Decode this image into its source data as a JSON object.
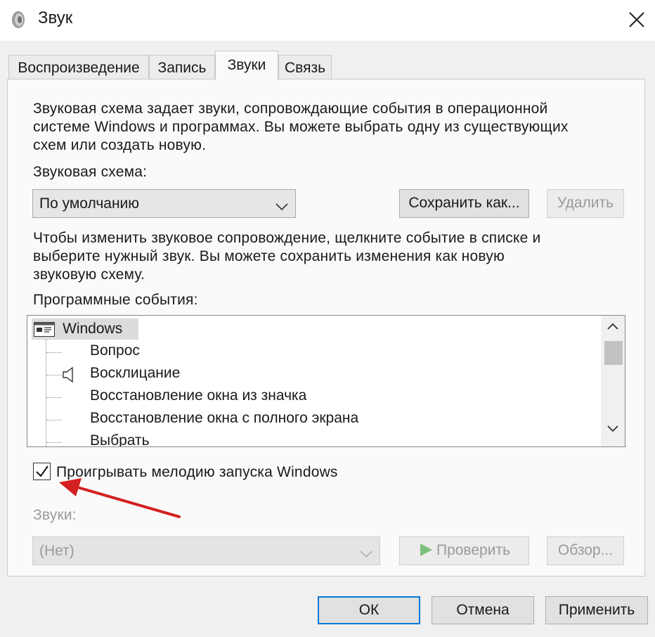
{
  "window": {
    "title": "Звук",
    "app_icon": "speaker-icon",
    "close_icon": "close-icon"
  },
  "tabs": [
    {
      "label": "Воспроизведение",
      "active": false
    },
    {
      "label": "Запись",
      "active": false
    },
    {
      "label": "Звуки",
      "active": true
    },
    {
      "label": "Связь",
      "active": false
    }
  ],
  "scheme": {
    "description": [
      "Звуковая схема задает звуки, сопровождающие события в операционной",
      "системе Windows и программах. Вы можете выбрать одну из существующих",
      "схем или создать новую."
    ],
    "label": "Звуковая схема:",
    "selected": "По умолчанию",
    "save_as_label": "Сохранить как...",
    "delete_label": "Удалить"
  },
  "events": {
    "instructions": [
      "Чтобы изменить звуковое сопровождение, щелкните событие в списке и",
      "выберите нужный звук. Вы можете сохранить изменения как новую",
      "звуковую схему."
    ],
    "label": "Программные события:",
    "root_label": "Windows",
    "items": [
      {
        "label": "Вопрос",
        "has_sound": false
      },
      {
        "label": "Восклицание",
        "has_sound": true
      },
      {
        "label": "Восстановление окна из значка",
        "has_sound": false
      },
      {
        "label": "Восстановление окна с полного экрана",
        "has_sound": false
      },
      {
        "label": "Выбрать",
        "has_sound": false
      }
    ]
  },
  "startup": {
    "label": "Проигрывать мелодию запуска Windows",
    "checked": true
  },
  "sounds": {
    "label": "Звуки:",
    "selected": "(Нет)",
    "test_label": "Проверить",
    "browse_label": "Обзор..."
  },
  "footer": {
    "ok_label": "ОК",
    "cancel_label": "Отмена",
    "apply_label": "Применить"
  },
  "colors": {
    "accent": "#0078d7",
    "annotation_arrow": "#d42020",
    "play_icon": "#7fc07f"
  }
}
